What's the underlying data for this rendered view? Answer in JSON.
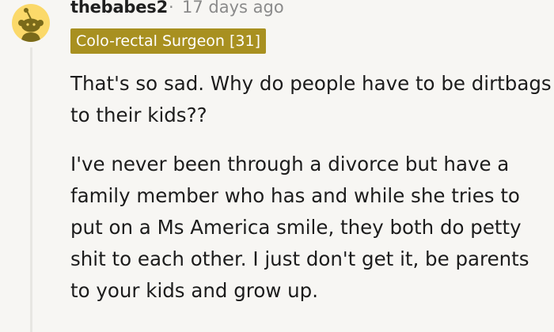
{
  "comment": {
    "author": "thebabes2",
    "separator": "·",
    "timestamp": "17 days ago",
    "flair": "Colo-rectal Surgeon [31]",
    "avatar_icon": "snoo-avatar-icon",
    "paragraphs": [
      "That's so sad. Why do people have to be dirtbags to their kids??",
      "I've never been through a divorce but have a family member who has and while she tries to put on a Ms America smile, they both do petty shit to each other. I just don't get it, be parents to your kids and grow up."
    ]
  },
  "colors": {
    "background": "#f7f6f3",
    "flair_background": "#a89020",
    "avatar_background": "#fbd96a"
  }
}
